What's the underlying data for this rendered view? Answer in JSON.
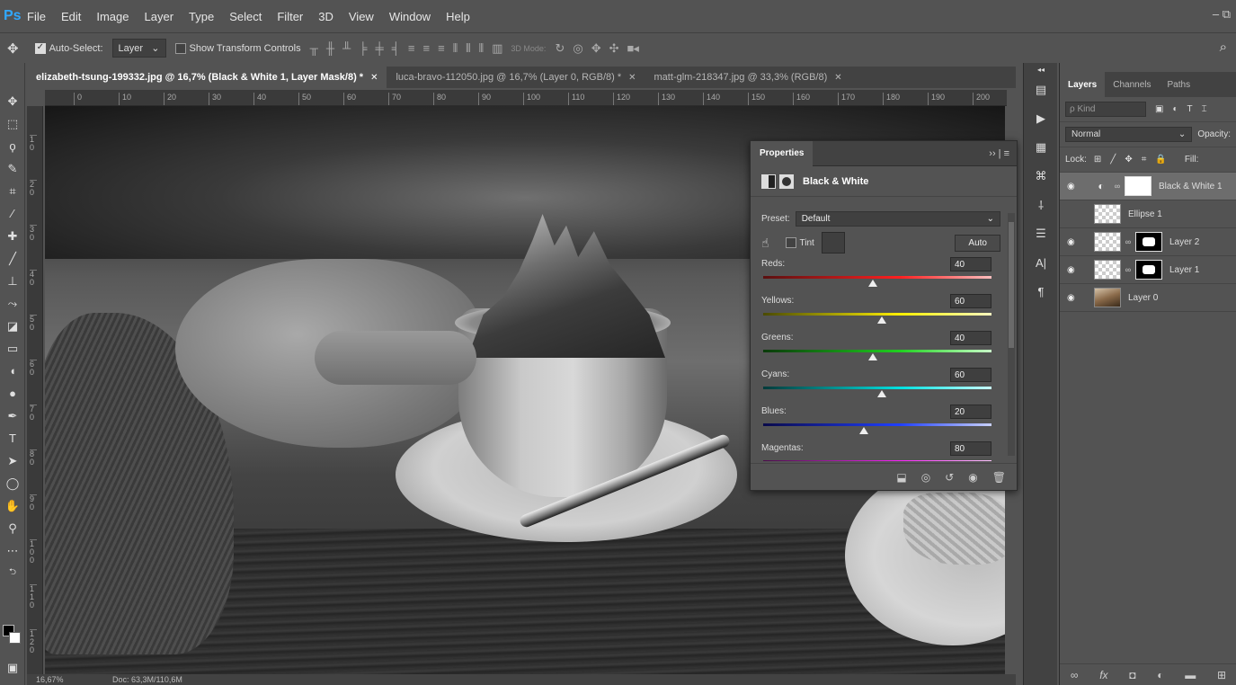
{
  "menubar": {
    "logo": "Ps",
    "items": [
      "File",
      "Edit",
      "Image",
      "Layer",
      "Type",
      "Select",
      "Filter",
      "3D",
      "View",
      "Window",
      "Help"
    ],
    "window_controls": "–  ⧉"
  },
  "options": {
    "move_icon": "✥",
    "auto_select_label": "Auto-Select:",
    "auto_select_checked": true,
    "auto_select_target": "Layer",
    "show_transform_label": "Show Transform Controls",
    "show_transform_checked": false,
    "mode_3d_label": "3D Mode:",
    "search_icon": "⌕"
  },
  "tabs": [
    {
      "label": "elizabeth-tsung-199332.jpg @ 16,7% (Black & White 1, Layer Mask/8) *",
      "active": true
    },
    {
      "label": "luca-bravo-112050.jpg @ 16,7% (Layer 0, RGB/8) *",
      "active": false
    },
    {
      "label": "matt-glm-218347.jpg @ 33,3% (RGB/8)",
      "active": false
    }
  ],
  "ruler_top": [
    "0",
    "10",
    "20",
    "30",
    "40",
    "50",
    "60",
    "70",
    "80",
    "90",
    "100",
    "110",
    "120",
    "130",
    "140",
    "150",
    "160",
    "170",
    "180",
    "190",
    "200"
  ],
  "ruler_left": [
    "1",
    "2",
    "3",
    "4",
    "5",
    "6",
    "7",
    "8",
    "9",
    "10",
    "11",
    "12"
  ],
  "status": {
    "zoom": "16,67%",
    "doc": "Doc: 63,3M/110,6M"
  },
  "properties": {
    "tab_label": "Properties",
    "collapse_label": "›› |  ≡",
    "adjustment_title": "Black & White",
    "preset_label": "Preset:",
    "preset_value": "Default",
    "tint_label": "Tint",
    "tint_checked": false,
    "auto_label": "Auto",
    "sliders": [
      {
        "label": "Reds:",
        "value": 40,
        "gradient": "linear-gradient(90deg,#5a1010,#ff2020 60%,#ffbfbf)"
      },
      {
        "label": "Yellows:",
        "value": 60,
        "gradient": "linear-gradient(90deg,#4a4a00,#fff000 60%,#fffbc0)"
      },
      {
        "label": "Greens:",
        "value": 40,
        "gradient": "linear-gradient(90deg,#0a3a0a,#20d020 60%,#c8ffc8)"
      },
      {
        "label": "Cyans:",
        "value": 60,
        "gradient": "linear-gradient(90deg,#003a3a,#00e0e0 60%,#c8ffff)"
      },
      {
        "label": "Blues:",
        "value": 20,
        "gradient": "linear-gradient(90deg,#0a0a4a,#2040ff 60%,#c8d0ff)"
      },
      {
        "label": "Magentas:",
        "value": 80,
        "gradient": "linear-gradient(90deg,#4a0a4a,#ff20ff 60%,#ffc8ff)"
      }
    ]
  },
  "layers_panel": {
    "tabs": [
      "Layers",
      "Channels",
      "Paths"
    ],
    "kind_placeholder": "ρ Kind",
    "blend_mode": "Normal",
    "opacity_label": "Opacity:",
    "lock_label": "Lock:",
    "fill_label": "Fill:",
    "layers": [
      {
        "name": "Black & White 1",
        "visible": true,
        "type": "adjustment",
        "selected": true
      },
      {
        "name": "Ellipse 1",
        "visible": false,
        "type": "shape",
        "selected": false
      },
      {
        "name": "Layer 2",
        "visible": true,
        "type": "masked",
        "selected": false
      },
      {
        "name": "Layer 1",
        "visible": true,
        "type": "masked",
        "selected": false
      },
      {
        "name": "Layer 0",
        "visible": true,
        "type": "photo",
        "selected": false
      }
    ]
  }
}
